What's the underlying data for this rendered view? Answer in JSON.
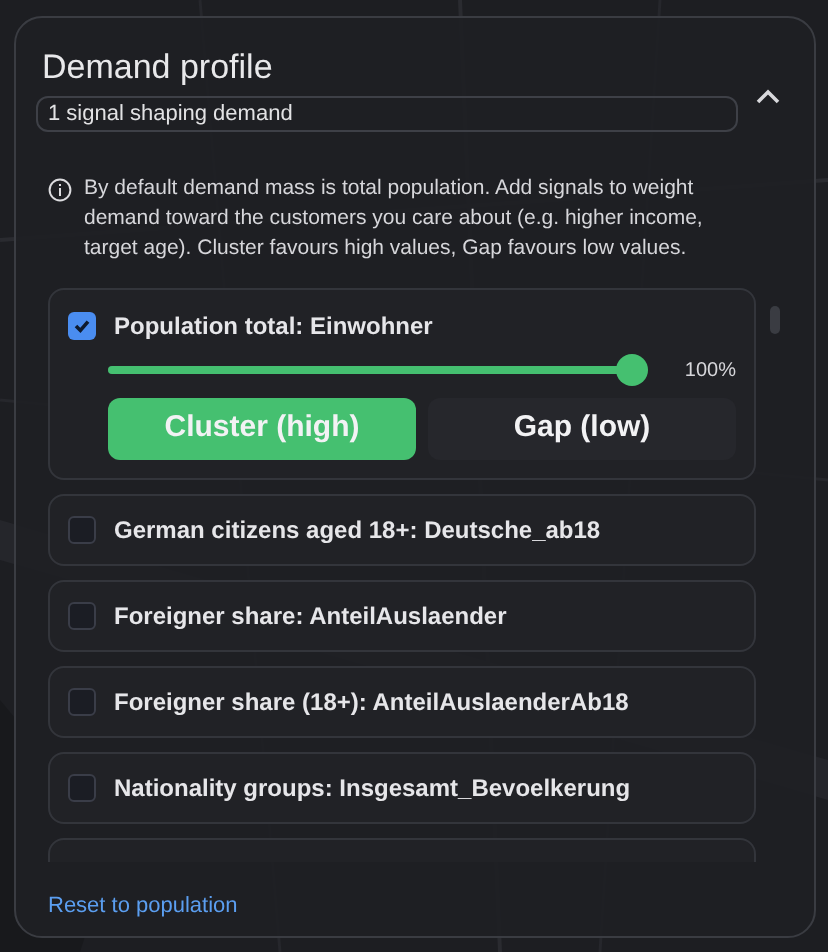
{
  "panel": {
    "title": "Demand profile",
    "expanded": true,
    "summary": "1 signal shaping demand",
    "info": "By default demand mass is total population. Add signals to weight demand toward the customers you care about (e.g. higher income, target age). Cluster favours high values, Gap favours low values.",
    "signals": [
      {
        "label": "Population total: Einwohner",
        "checked": true,
        "level": 1,
        "reading": "100%",
        "modes": [
          {
            "label": "Cluster (high)",
            "selected": true
          },
          {
            "label": "Gap (low)",
            "selected": false
          }
        ]
      },
      {
        "label": "German citizens aged 18+: Deutsche_ab18",
        "checked": false
      },
      {
        "label": "Foreigner share: AnteilAuslaender",
        "checked": false
      },
      {
        "label": "Foreigner share (18+): AnteilAuslaenderAb18",
        "checked": false
      },
      {
        "label": "Nationality groups: Insgesamt_Bevoelkerung",
        "checked": false
      }
    ],
    "reset_link": "Reset to population"
  }
}
